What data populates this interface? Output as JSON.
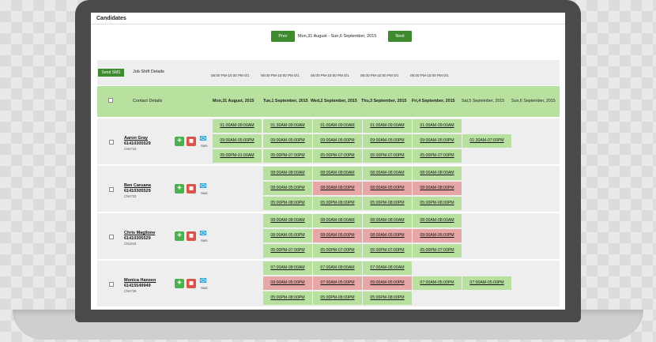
{
  "header": {
    "title": "Candidates",
    "prev_label": "Prev",
    "next_label": "Next",
    "date_range": "Mon,31 August - Sun,6 September, 2015"
  },
  "table": {
    "send_sms_label": "Send SMS",
    "job_shift_label": "Job Shift Details",
    "contact_details_label": "Contact Details",
    "shift_columns": [
      "06:00 PM-10:00 PM 0/1",
      "06:00 PM-10:00 PM 0/1",
      "06:00 PM-10:00 PM 0/1",
      "06:00 PM-10:00 PM 0/1",
      "06:00 PM-10:00 PM 0/1"
    ],
    "days": [
      "Mon,31 August, 2015",
      "Tue,1 September, 2015",
      "Wed,2 September, 2015",
      "Thu,3 September, 2015",
      "Fri,4 September, 2015",
      "Sat,5 September, 2015",
      "Sun,6 September, 2015"
    ]
  },
  "candidates": [
    {
      "name": "Aaron Gray",
      "phone": "61410305529",
      "id": "CN4723",
      "sms": "SMS",
      "shifts": [
        {
          "day": 0,
          "slot": 0,
          "time": "01:00AM-09:00AM",
          "status": "available"
        },
        {
          "day": 0,
          "slot": 1,
          "time": "09:00AM-05:00PM",
          "status": "available"
        },
        {
          "day": 0,
          "slot": 2,
          "time": "05:00PM-01:00AM",
          "status": "available"
        },
        {
          "day": 1,
          "slot": 0,
          "time": "01:30AM-09:00AM",
          "status": "available"
        },
        {
          "day": 1,
          "slot": 1,
          "time": "09:00AM-05:00PM",
          "status": "available"
        },
        {
          "day": 1,
          "slot": 2,
          "time": "05:00PM-07:00PM",
          "status": "available"
        },
        {
          "day": 2,
          "slot": 0,
          "time": "01:00AM-09:00AM",
          "status": "available"
        },
        {
          "day": 2,
          "slot": 1,
          "time": "09:00AM-05:00PM",
          "status": "available"
        },
        {
          "day": 2,
          "slot": 2,
          "time": "05:00PM-07:00PM",
          "status": "available"
        },
        {
          "day": 3,
          "slot": 0,
          "time": "01:00AM-09:00AM",
          "status": "available"
        },
        {
          "day": 3,
          "slot": 1,
          "time": "09:00AM-05:00PM",
          "status": "available"
        },
        {
          "day": 3,
          "slot": 2,
          "time": "05:00PM-07:00PM",
          "status": "available"
        },
        {
          "day": 4,
          "slot": 0,
          "time": "01:00AM-09:00AM",
          "status": "available"
        },
        {
          "day": 4,
          "slot": 1,
          "time": "09:00AM-05:00PM",
          "status": "available"
        },
        {
          "day": 4,
          "slot": 2,
          "time": "05:00PM-07:00PM",
          "status": "available"
        },
        {
          "day": 5,
          "slot": 1,
          "time": "01:30AM-07:00PM",
          "status": "available"
        }
      ]
    },
    {
      "name": "Ben Caruana",
      "phone": "61410305529",
      "id": "CN4723",
      "sms": "SMS",
      "shifts": [
        {
          "day": 1,
          "slot": 0,
          "time": "08:00AM-08:00AM",
          "status": "available"
        },
        {
          "day": 1,
          "slot": 1,
          "time": "08:00AM-05:00PM",
          "status": "available"
        },
        {
          "day": 1,
          "slot": 2,
          "time": "05:00PM-08:00PM",
          "status": "available"
        },
        {
          "day": 2,
          "slot": 0,
          "time": "08:00AM-08:00AM",
          "status": "available"
        },
        {
          "day": 2,
          "slot": 1,
          "time": "08:00AM-08:00PM",
          "status": "unavailable"
        },
        {
          "day": 2,
          "slot": 2,
          "time": "05:00PM-08:00PM",
          "status": "available"
        },
        {
          "day": 3,
          "slot": 0,
          "time": "08:00AM-08:00AM",
          "status": "available"
        },
        {
          "day": 3,
          "slot": 1,
          "time": "08:00AM-05:00PM",
          "status": "unavailable"
        },
        {
          "day": 3,
          "slot": 2,
          "time": "05:00PM-08:00PM",
          "status": "available"
        },
        {
          "day": 4,
          "slot": 0,
          "time": "08:00AM-08:00AM",
          "status": "available"
        },
        {
          "day": 4,
          "slot": 1,
          "time": "08:00AM-08:00PM",
          "status": "unavailable"
        },
        {
          "day": 4,
          "slot": 2,
          "time": "05:00PM-08:00PM",
          "status": "available"
        }
      ]
    },
    {
      "name": "Chris Magilone",
      "phone": "61410305529",
      "id": "CN1019",
      "sms": "SMS",
      "shifts": [
        {
          "day": 1,
          "slot": 0,
          "time": "08:00AM-08:00AM",
          "status": "available"
        },
        {
          "day": 1,
          "slot": 1,
          "time": "08:00AM-05:00PM",
          "status": "available"
        },
        {
          "day": 1,
          "slot": 2,
          "time": "05:00PM-07:00PM",
          "status": "available"
        },
        {
          "day": 2,
          "slot": 0,
          "time": "08:00AM-08:00AM",
          "status": "available"
        },
        {
          "day": 2,
          "slot": 1,
          "time": "08:00AM-05:00PM",
          "status": "unavailable"
        },
        {
          "day": 2,
          "slot": 2,
          "time": "05:00PM-07:00PM",
          "status": "available"
        },
        {
          "day": 3,
          "slot": 0,
          "time": "08:00AM-08:00AM",
          "status": "available"
        },
        {
          "day": 3,
          "slot": 1,
          "time": "08:00AM-05:00PM",
          "status": "unavailable"
        },
        {
          "day": 3,
          "slot": 2,
          "time": "05:00PM-07:00PM",
          "status": "available"
        },
        {
          "day": 4,
          "slot": 0,
          "time": "08:00AM-08:00AM",
          "status": "available"
        },
        {
          "day": 4,
          "slot": 1,
          "time": "08:00AM-05:00PM",
          "status": "unavailable"
        },
        {
          "day": 4,
          "slot": 2,
          "time": "05:00PM-07:00PM",
          "status": "available"
        }
      ]
    },
    {
      "name": "Monica Hansen",
      "phone": "61415549949",
      "id": "CN4726",
      "sms": "SMS",
      "shifts": [
        {
          "day": 1,
          "slot": 0,
          "time": "07:00AM-08:00AM",
          "status": "available"
        },
        {
          "day": 1,
          "slot": 1,
          "time": "09:00AM-05:00PM",
          "status": "unavailable"
        },
        {
          "day": 1,
          "slot": 2,
          "time": "05:00PM-08:00PM",
          "status": "available"
        },
        {
          "day": 2,
          "slot": 0,
          "time": "07:00AM-08:00AM",
          "status": "available"
        },
        {
          "day": 2,
          "slot": 1,
          "time": "07:00AM-05:00PM",
          "status": "unavailable"
        },
        {
          "day": 2,
          "slot": 2,
          "time": "05:00PM-08:00PM",
          "status": "available"
        },
        {
          "day": 3,
          "slot": 0,
          "time": "07:00AM-08:00AM",
          "status": "available"
        },
        {
          "day": 3,
          "slot": 1,
          "time": "09:00AM-05:00PM",
          "status": "unavailable"
        },
        {
          "day": 3,
          "slot": 2,
          "time": "05:00PM-08:00PM",
          "status": "available"
        },
        {
          "day": 4,
          "slot": 1,
          "time": "07:00AM-05:00PM",
          "status": "available"
        },
        {
          "day": 5,
          "slot": 1,
          "time": "07:00AM-05:00PM",
          "status": "available"
        }
      ]
    }
  ]
}
